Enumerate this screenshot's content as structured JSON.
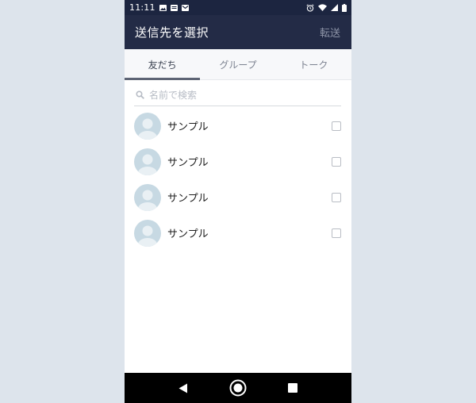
{
  "status_bar": {
    "time": "11:11",
    "icons_left": [
      "image-icon",
      "message-icon",
      "mail-icon"
    ],
    "icons_right": [
      "alarm-icon",
      "wifi-icon",
      "signal-icon",
      "battery-icon"
    ]
  },
  "app_bar": {
    "title": "送信先を選択",
    "action_label": "転送"
  },
  "tabs": [
    {
      "label": "友だち",
      "active": true
    },
    {
      "label": "グループ",
      "active": false
    },
    {
      "label": "トーク",
      "active": false
    }
  ],
  "search": {
    "placeholder": "名前で検索"
  },
  "contacts": [
    {
      "name": "サンプル",
      "checked": false
    },
    {
      "name": "サンプル",
      "checked": false
    },
    {
      "name": "サンプル",
      "checked": false
    },
    {
      "name": "サンプル",
      "checked": false
    }
  ],
  "nav_bar": {
    "buttons": [
      "back-icon",
      "home-icon",
      "recents-icon"
    ]
  },
  "colors": {
    "app_bar": "#232b46",
    "status_bar": "#1c2540",
    "page_background": "#dde4ec",
    "avatar": "#c7d9e3"
  }
}
